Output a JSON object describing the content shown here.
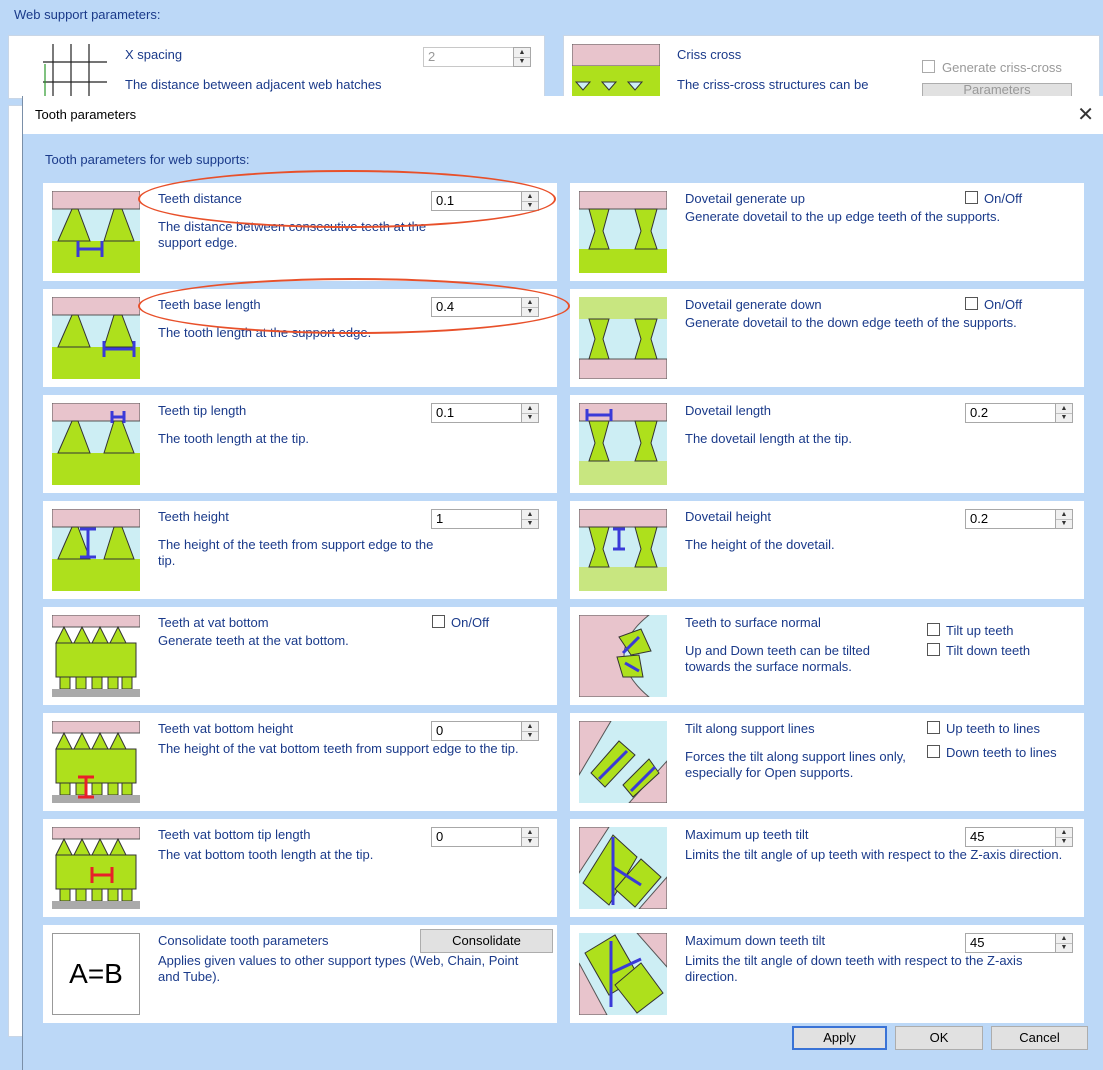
{
  "background": {
    "title": "Web support parameters:",
    "x_spacing": {
      "title": "X spacing",
      "desc": "The distance between adjacent web hatches",
      "value": "2"
    },
    "criss_cross": {
      "title": "Criss cross",
      "desc": "The criss-cross structures can be",
      "checkbox_label": "Generate criss-cross",
      "button_label": "Parameters"
    }
  },
  "dialog": {
    "title": "Tooth parameters",
    "section_label": "Tooth parameters for web supports:",
    "left": [
      {
        "title": "Teeth distance",
        "desc": "The distance between consecutive teeth at the support edge.",
        "value": "0.1"
      },
      {
        "title": "Teeth base length",
        "desc": "The tooth length at the support edge.",
        "value": "0.4"
      },
      {
        "title": "Teeth tip length",
        "desc": "The tooth length at the tip.",
        "value": "0.1"
      },
      {
        "title": "Teeth height",
        "desc": "The height of the teeth from support edge to the tip.",
        "value": "1"
      },
      {
        "title": "Teeth at vat bottom",
        "desc": "Generate teeth at the vat bottom.",
        "toggle_label": "On/Off"
      },
      {
        "title": "Teeth vat bottom height",
        "desc": "The height of the vat bottom teeth from support edge to the tip.",
        "value": "0"
      },
      {
        "title": "Teeth vat bottom tip length",
        "desc": "The vat bottom tooth length at the tip.",
        "value": "0"
      },
      {
        "title": "Consolidate tooth parameters",
        "desc": "Applies given values to other support types (Web, Chain, Point and Tube).",
        "button_label": "Consolidate",
        "thumb_text": "A=B"
      }
    ],
    "right": [
      {
        "title": "Dovetail generate up",
        "desc": "Generate dovetail to the up edge teeth of the supports.",
        "toggle_label": "On/Off"
      },
      {
        "title": "Dovetail generate down",
        "desc": "Generate dovetail to the down edge teeth of the supports.",
        "toggle_label": "On/Off"
      },
      {
        "title": "Dovetail length",
        "desc": "The dovetail length at the tip.",
        "value": "0.2"
      },
      {
        "title": "Dovetail height",
        "desc": "The height of the dovetail.",
        "value": "0.2"
      },
      {
        "title": "Teeth to surface normal",
        "desc": "Up and Down teeth can be tilted towards the surface normals.",
        "check1": "Tilt up teeth",
        "check2": "Tilt down teeth"
      },
      {
        "title": "Tilt along support lines",
        "desc": "Forces the tilt along support lines only, especially for Open supports.",
        "check1": "Up teeth to lines",
        "check2": "Down teeth to lines"
      },
      {
        "title": "Maximum up teeth tilt",
        "desc": "Limits the tilt angle of up teeth with respect to the Z-axis direction.",
        "value": "45"
      },
      {
        "title": "Maximum down teeth tilt",
        "desc": "Limits the tilt angle of down teeth with respect to the Z-axis direction.",
        "value": "45"
      }
    ],
    "buttons": {
      "apply": "Apply",
      "ok": "OK",
      "cancel": "Cancel"
    }
  },
  "colors": {
    "dialog_bg": "#bcd8f7",
    "label_text": "#1a3a8a",
    "tooth_green": "#aee01c",
    "pink": "#e8c4cc",
    "light_blue": "#cdeef4",
    "marker_blue": "#3a3ad8",
    "highlight_red": "#e8502a"
  }
}
